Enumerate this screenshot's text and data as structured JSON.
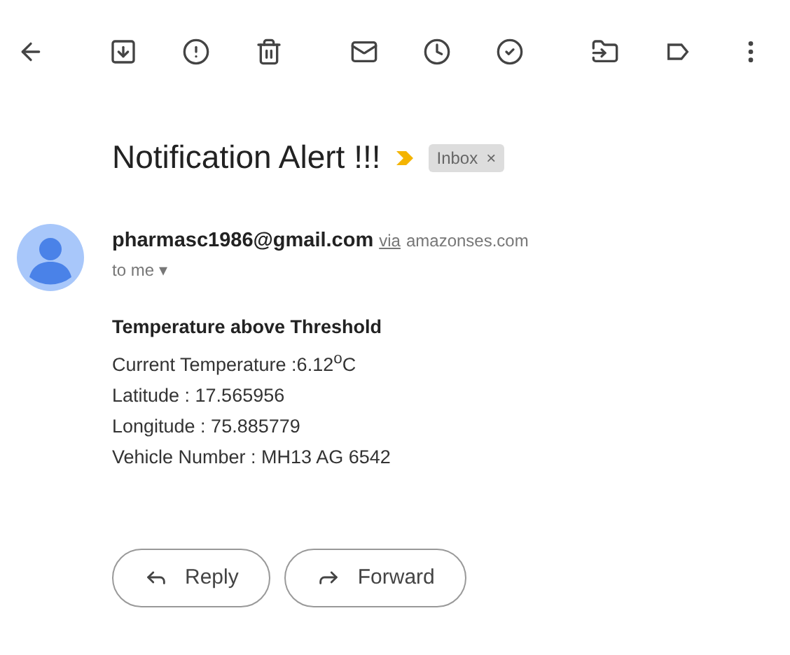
{
  "subject": "Notification Alert !!!",
  "important": true,
  "labels": [
    {
      "label": "Inbox",
      "remove": "×"
    }
  ],
  "sender": {
    "email": "pharmasc1986@gmail.com",
    "via": "via",
    "domain": "amazonses.com"
  },
  "recipient": {
    "label": "to me",
    "caret": "▾"
  },
  "body": {
    "heading": "Temperature above Threshold",
    "lines": [
      "Current Temperature :6.12$^{o}$C",
      "Latitude : 17.565956",
      "Longitude : 75.885779",
      "Vehicle Number : MH13 AG 6542"
    ]
  },
  "actions": [
    {
      "kind": "reply",
      "label": "Reply"
    },
    {
      "kind": "forward",
      "label": "Forward"
    }
  ]
}
